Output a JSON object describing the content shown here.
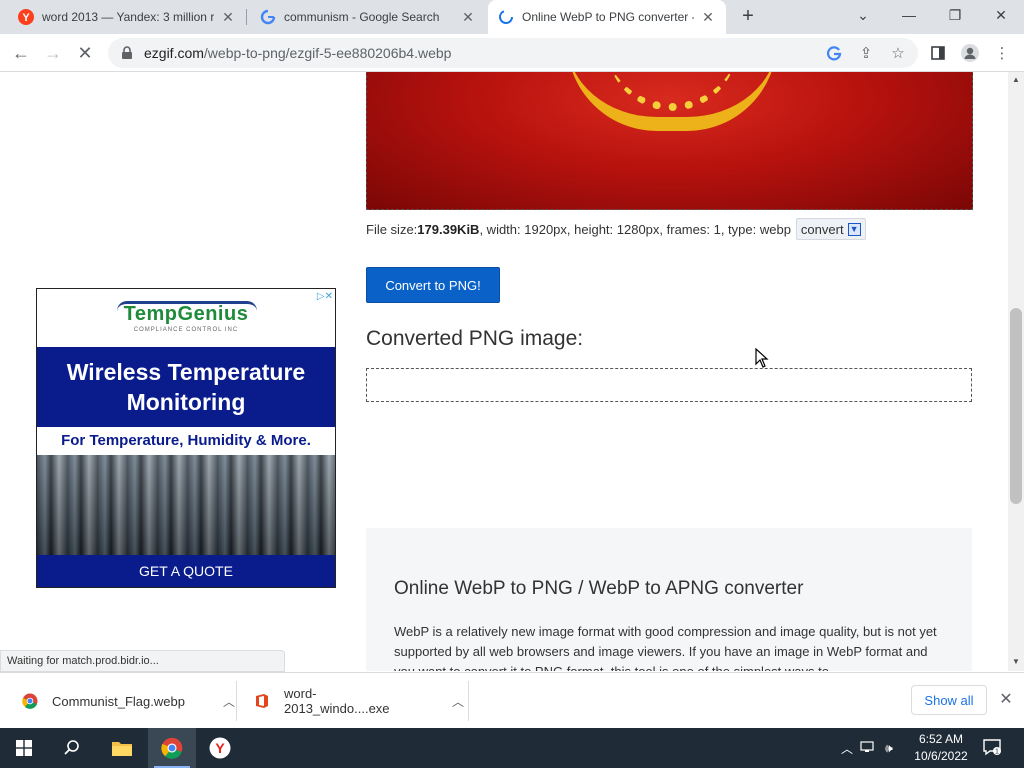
{
  "browser": {
    "tabs": [
      {
        "label": "word 2013 — Yandex: 3 million r",
        "favicon": "yandex-icon"
      },
      {
        "label": "communism - Google Search",
        "favicon": "google-icon"
      },
      {
        "label": "Online WebP to PNG converter -",
        "favicon": "loading-spinner-icon",
        "active": true
      }
    ],
    "address": {
      "domain": "ezgif.com",
      "path": "/webp-to-png/ezgif-5-ee880206b4.webp"
    }
  },
  "page": {
    "file_info": {
      "prefix": "File size: ",
      "size": "179.39KiB",
      "rest": ", width: 1920px, height: 1280px, frames: 1, type: webp"
    },
    "convert_mini_label": "convert",
    "convert_button": "Convert to PNG!",
    "converted_heading": "Converted PNG image:",
    "about": {
      "heading": "Online WebP to PNG / WebP to APNG converter",
      "text": "WebP is a relatively new image format with good compression and image quality, but is not yet supported by all web browsers and image viewers. If you have an image in WebP format and you want to convert it to PNG format, this tool is one of the simplest ways to"
    },
    "ad": {
      "logo": "TempGenius",
      "logo_sub": "COMPLIANCE CONTROL INC",
      "headline": "Wireless Temperature Monitoring",
      "subline": "For Temperature, Humidity & More.",
      "cta": "GET A QUOTE"
    },
    "status": "Waiting for match.prod.bidr.io..."
  },
  "downloads": [
    {
      "name": "Communist_Flag.webp",
      "icon": "chrome-file-icon"
    },
    {
      "name": "word-2013_windo....exe",
      "icon": "office-icon"
    }
  ],
  "downloads_show_all": "Show all",
  "taskbar": {
    "time": "6:52 AM",
    "date": "10/6/2022"
  }
}
